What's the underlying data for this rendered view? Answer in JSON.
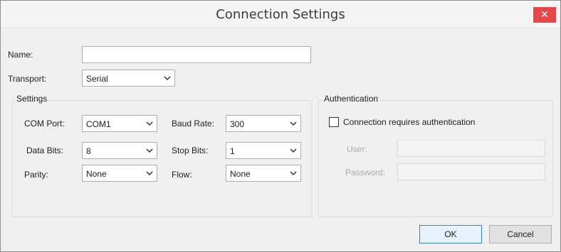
{
  "window": {
    "title": "Connection Settings",
    "close_glyph": "✕"
  },
  "form": {
    "name_label": "Name:",
    "name_value": "",
    "transport_label": "Transport:",
    "transport_value": "Serial"
  },
  "settings": {
    "group_label": "Settings",
    "com_port_label": "COM Port:",
    "com_port_value": "COM1",
    "baud_rate_label": "Baud Rate:",
    "baud_rate_value": "300",
    "data_bits_label": "Data Bits:",
    "data_bits_value": "8",
    "stop_bits_label": "Stop Bits:",
    "stop_bits_value": "1",
    "parity_label": "Parity:",
    "parity_value": "None",
    "flow_label": "Flow:",
    "flow_value": "None"
  },
  "auth": {
    "group_label": "Authentication",
    "checkbox_label": "Connection requires authentication",
    "checked": false,
    "user_label": "User:",
    "user_value": "",
    "password_label": "Password:",
    "password_value": ""
  },
  "buttons": {
    "ok": "OK",
    "cancel": "Cancel"
  },
  "colors": {
    "close_button": "#e4474a",
    "default_button_border": "#3c7fb1",
    "window_bg": "#f0f0f0"
  },
  "icons": {
    "dropdown": "chevron-down-icon",
    "close": "close-icon"
  }
}
